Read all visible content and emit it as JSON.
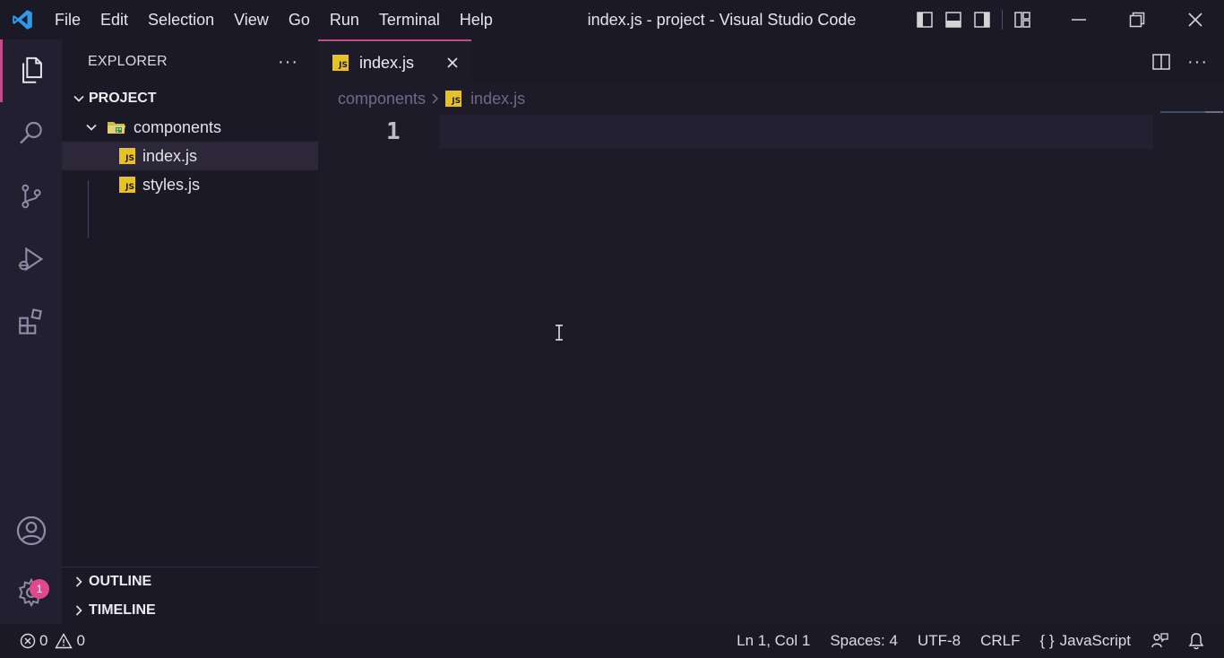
{
  "window": {
    "title": "index.js - project - Visual Studio Code"
  },
  "menu": [
    "File",
    "Edit",
    "Selection",
    "View",
    "Go",
    "Run",
    "Terminal",
    "Help"
  ],
  "activity": {
    "items": [
      "explorer-icon",
      "search-icon",
      "source-control-icon",
      "run-debug-icon",
      "extensions-icon"
    ],
    "bottom": [
      "account-icon",
      "settings-gear-icon"
    ],
    "settings_badge": "1"
  },
  "sidebar": {
    "title": "EXPLORER",
    "more": "···",
    "project": {
      "label": "PROJECT",
      "folder": "components",
      "files": [
        "index.js",
        "styles.js"
      ]
    },
    "outline": "OUTLINE",
    "timeline": "TIMELINE"
  },
  "tab": {
    "label": "index.js",
    "icon_text": "JS"
  },
  "breadcrumb": {
    "folder": "components",
    "file": "index.js"
  },
  "editor": {
    "line_number": "1"
  },
  "status": {
    "errors": "0",
    "warnings": "0",
    "position": "Ln 1, Col 1",
    "spaces": "Spaces: 4",
    "encoding": "UTF-8",
    "eol": "CRLF",
    "language": "JavaScript",
    "language_icon": "{ }"
  },
  "colors": {
    "accent": "#c34b8a",
    "badge": "#e2488f",
    "js": "#e6c225"
  }
}
